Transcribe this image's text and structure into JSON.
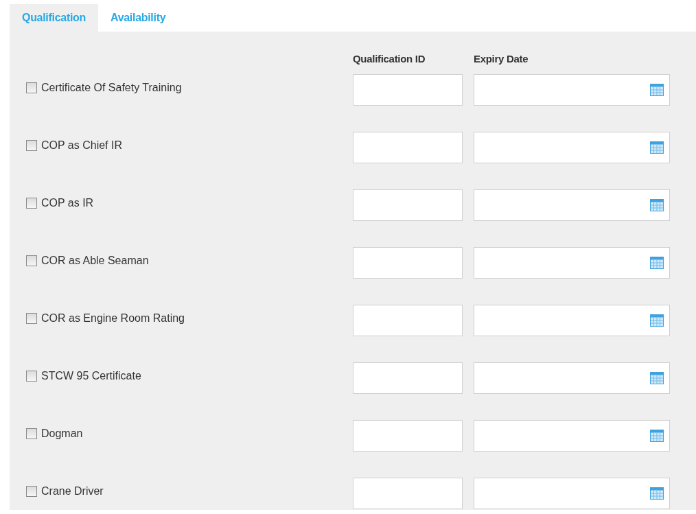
{
  "tabs": [
    {
      "label": "Qualification",
      "selected": true
    },
    {
      "label": "Availability",
      "selected": false
    }
  ],
  "columns": [
    "Qualification ID",
    "Expiry Date"
  ],
  "rows": [
    {
      "label": "Certificate Of Safety Training",
      "checked": false
    },
    {
      "label": "COP as Chief IR",
      "checked": false
    },
    {
      "label": "COP as IR",
      "checked": false
    },
    {
      "label": "COR as Able Seaman",
      "checked": false
    },
    {
      "label": "COR as Engine Room Rating",
      "checked": false
    },
    {
      "label": "STCW 95 Certificate",
      "checked": false
    },
    {
      "label": "Dogman",
      "checked": false
    },
    {
      "label": "Crane Driver",
      "checked": false
    }
  ]
}
